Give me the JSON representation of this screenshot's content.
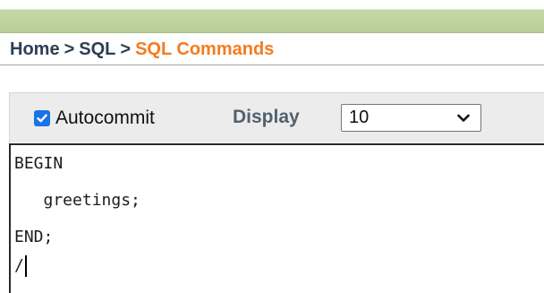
{
  "breadcrumb": {
    "items": [
      "Home",
      "SQL",
      "SQL Commands"
    ],
    "separator": ">"
  },
  "toolbar": {
    "autocommit_label": "Autocommit",
    "autocommit_checked": true,
    "display_label": "Display",
    "display_value": "10"
  },
  "editor": {
    "lines": [
      "BEGIN",
      "   greetings;",
      "END;",
      "/"
    ]
  },
  "colors": {
    "header_bar": "#b7cf96",
    "breadcrumb_text": "#2d3f52",
    "breadcrumb_current": "#f47b20",
    "checkbox_accent": "#1a73e8",
    "toolbar_bg": "#ececec"
  },
  "icons": {
    "checkbox": "checkmark-icon",
    "select": "chevron-down-icon"
  }
}
